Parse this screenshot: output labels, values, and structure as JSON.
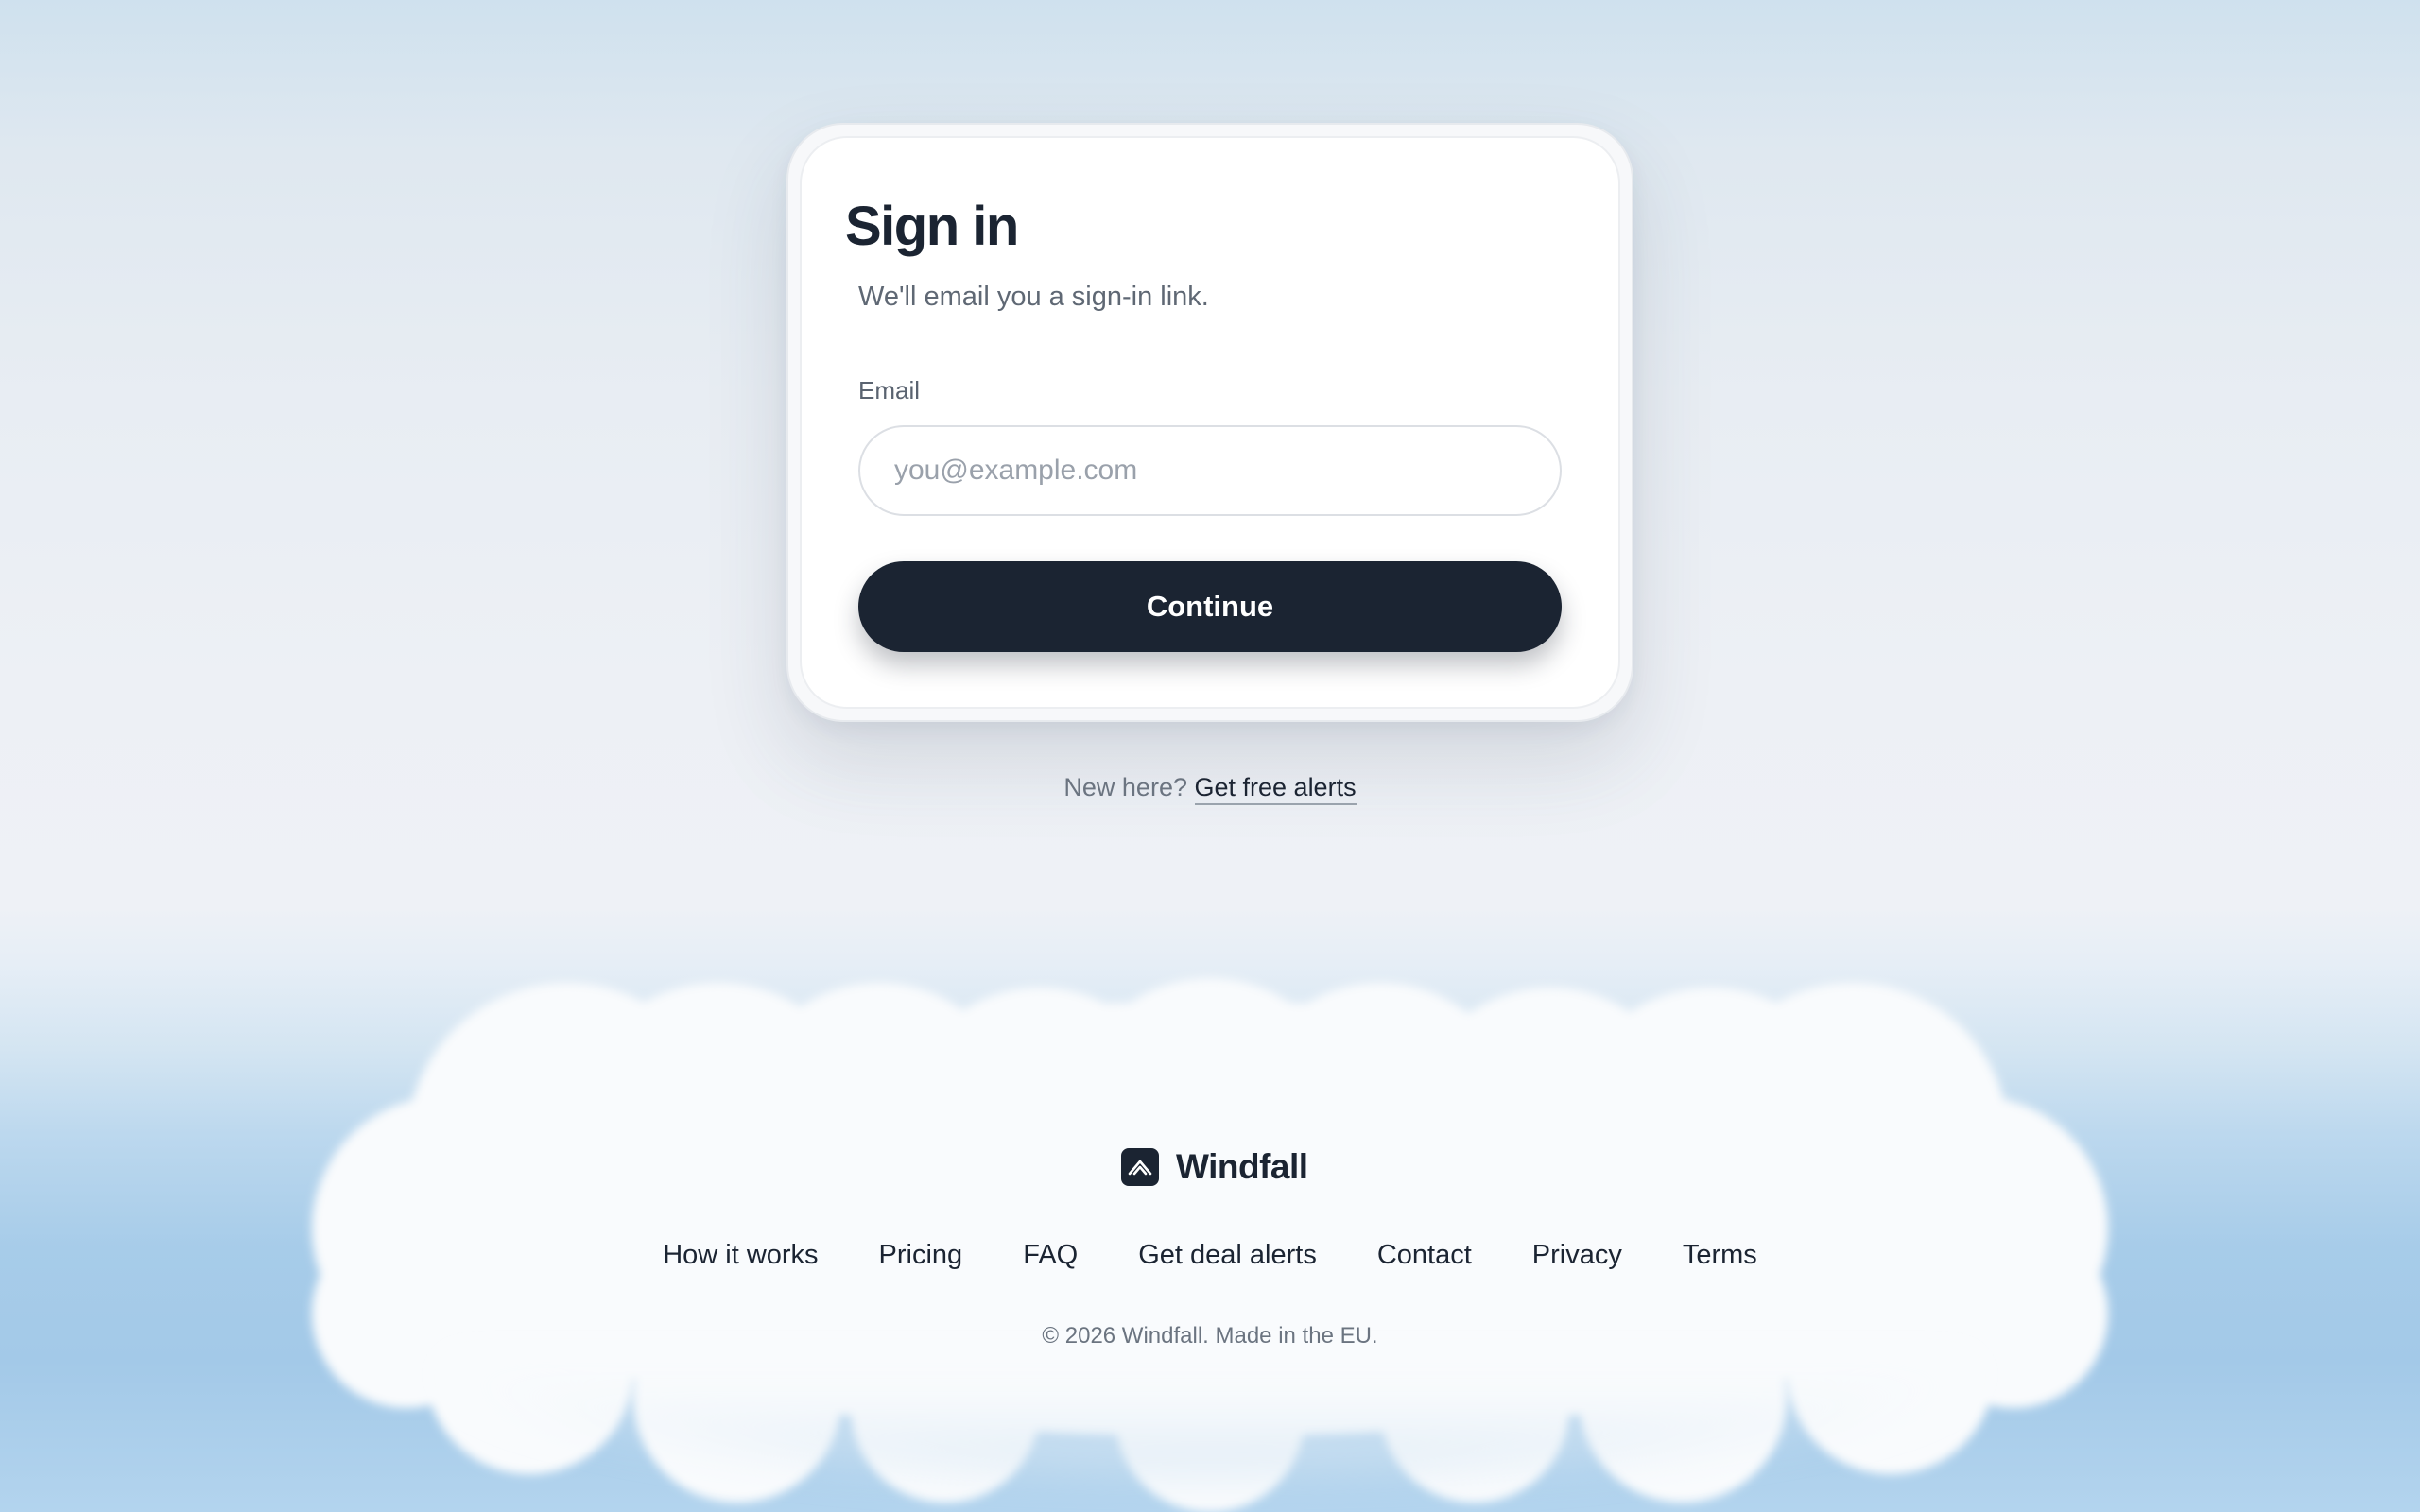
{
  "signin": {
    "title": "Sign in",
    "subtitle": "We'll email you a sign-in link.",
    "email_label": "Email",
    "email_placeholder": "you@example.com",
    "email_value": "",
    "continue_label": "Continue"
  },
  "signup_prompt": {
    "text": "New here?",
    "link_label": "Get free alerts"
  },
  "footer": {
    "brand_name": "Windfall",
    "brand_icon": "windfall-logo-icon",
    "nav": [
      {
        "label": "How it works"
      },
      {
        "label": "Pricing"
      },
      {
        "label": "FAQ"
      },
      {
        "label": "Get deal alerts"
      },
      {
        "label": "Contact"
      },
      {
        "label": "Privacy"
      },
      {
        "label": "Terms"
      }
    ],
    "copyright": "© 2026 Windfall. Made in the EU."
  },
  "colors": {
    "primary": "#1b2432",
    "muted_text": "#6b7480",
    "sky": "#a7cce9",
    "card": "#ffffff"
  }
}
